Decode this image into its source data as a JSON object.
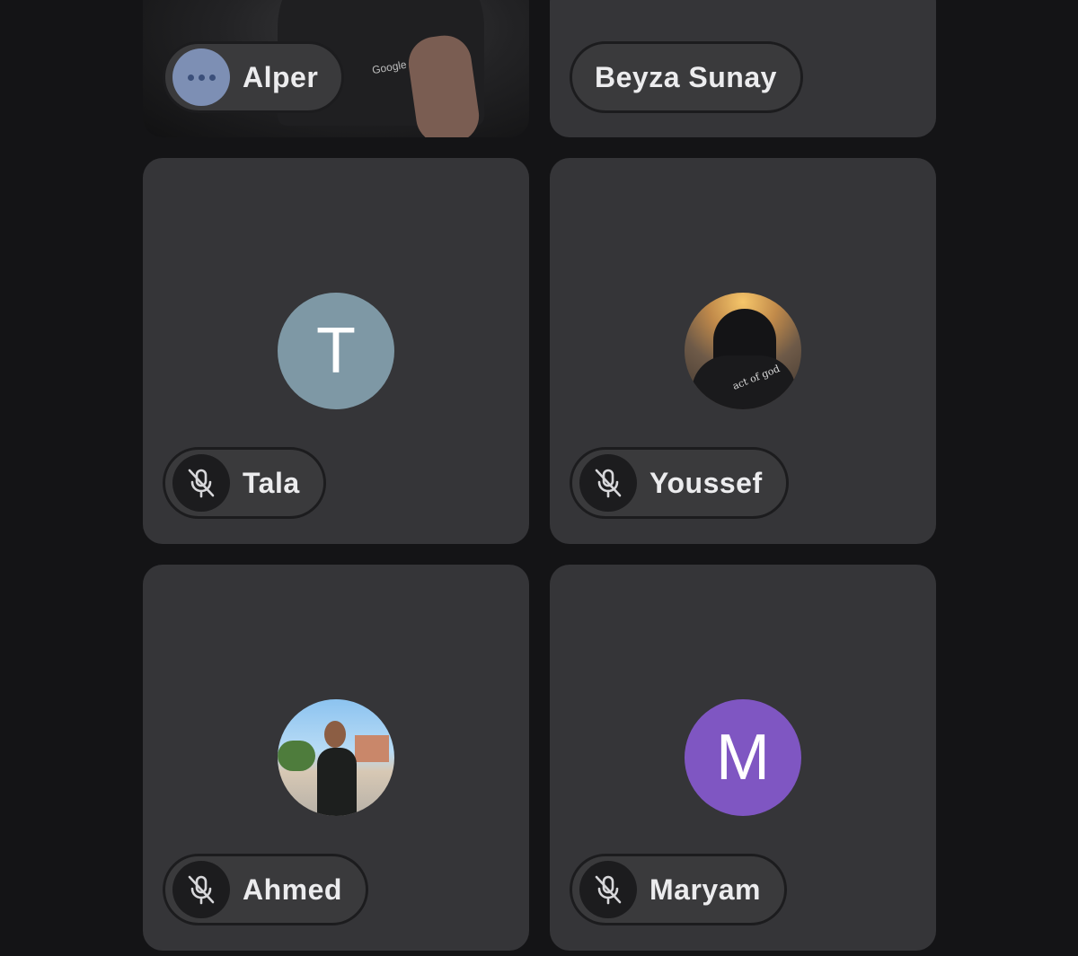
{
  "participants": [
    {
      "name": "Alper",
      "status": "more",
      "media": "video"
    },
    {
      "name": "Beyza Sunay",
      "status": "none",
      "media": "photo"
    },
    {
      "name": "Tala",
      "status": "muted",
      "media": "initial",
      "initial": "T",
      "avatar_color": "#7e98a5"
    },
    {
      "name": "Youssef",
      "status": "muted",
      "media": "photo"
    },
    {
      "name": "Ahmed",
      "status": "muted",
      "media": "photo"
    },
    {
      "name": "Maryam",
      "status": "muted",
      "media": "initial",
      "initial": "M",
      "avatar_color": "#7f56c2"
    }
  ],
  "video_overlay_text": "Google",
  "youssef_shirt_text": "act of god",
  "icons": {
    "more": "more-horizontal-icon",
    "muted": "mic-off-icon"
  },
  "colors": {
    "background": "#141416",
    "tile": "#353538",
    "pill": "#3a3a3c",
    "text": "#ececee"
  }
}
